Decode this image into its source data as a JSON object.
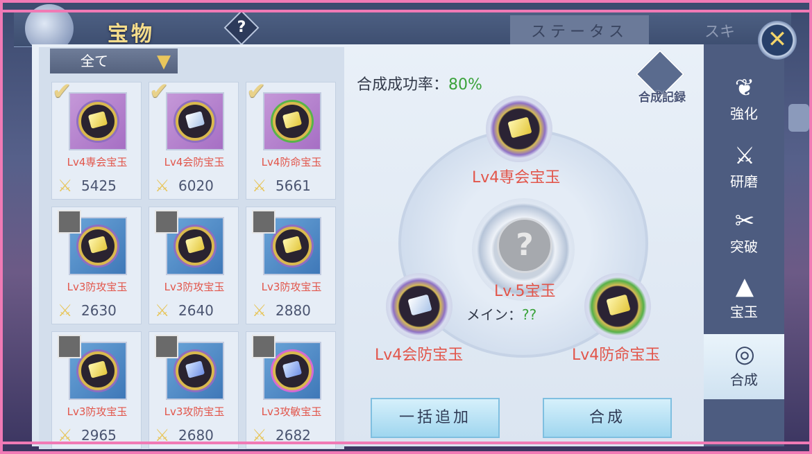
{
  "header": {
    "title": "宝物",
    "help": "?",
    "tabs": [
      "ステータス",
      "スキ"
    ],
    "close": "✕"
  },
  "filter": {
    "selected": "全て"
  },
  "inventory": [
    {
      "name": "Lv4専会宝玉",
      "power": "5425",
      "frame": "purple",
      "stone": "gold",
      "ring": "purple",
      "selected": true
    },
    {
      "name": "Lv4会防宝玉",
      "power": "6020",
      "frame": "purple",
      "stone": "silver",
      "ring": "purple",
      "selected": true
    },
    {
      "name": "Lv4防命宝玉",
      "power": "5661",
      "frame": "purple",
      "stone": "gold",
      "ring": "green",
      "selected": true
    },
    {
      "name": "Lv3防攻宝玉",
      "power": "2630",
      "frame": "blue",
      "stone": "gold",
      "ring": "purple",
      "selected": false
    },
    {
      "name": "Lv3防攻宝玉",
      "power": "2640",
      "frame": "blue",
      "stone": "gold",
      "ring": "purple",
      "selected": false
    },
    {
      "name": "Lv3防攻宝玉",
      "power": "2880",
      "frame": "blue",
      "stone": "gold",
      "ring": "purple",
      "selected": false
    },
    {
      "name": "Lv3防攻宝玉",
      "power": "2965",
      "frame": "blue",
      "stone": "gold",
      "ring": "purple",
      "selected": false
    },
    {
      "name": "Lv3攻防宝玉",
      "power": "2680",
      "frame": "blue",
      "stone": "blue",
      "ring": "purple",
      "selected": false
    },
    {
      "name": "Lv3攻敏宝玉",
      "power": "2682",
      "frame": "blue",
      "stone": "blue",
      "ring": "pink",
      "selected": false
    }
  ],
  "synthesis": {
    "rate_label": "合成成功率：",
    "rate_value": "80%",
    "record_label": "合成記録",
    "top_slot": "Lv4専会宝玉",
    "left_slot": "Lv4会防宝玉",
    "right_slot": "Lv4防命宝玉",
    "result_label": "Lv.5宝玉",
    "main_label": "メイン：",
    "main_value": "??",
    "unknown": "?",
    "add_all_button": "一括追加",
    "synth_button": "合成"
  },
  "sidenav": [
    {
      "label": "強化",
      "icon": "feather-icon"
    },
    {
      "label": "研磨",
      "icon": "whetstone-icon"
    },
    {
      "label": "突破",
      "icon": "sword-break-icon"
    },
    {
      "label": "宝玉",
      "icon": "gem-altar-icon"
    },
    {
      "label": "合成",
      "icon": "swirl-icon",
      "active": true
    }
  ],
  "colors": {
    "accent_red": "#e2554a",
    "success_green": "#3aa23a",
    "gold": "#e9c65c",
    "frame_pink": "#f07ab5"
  }
}
